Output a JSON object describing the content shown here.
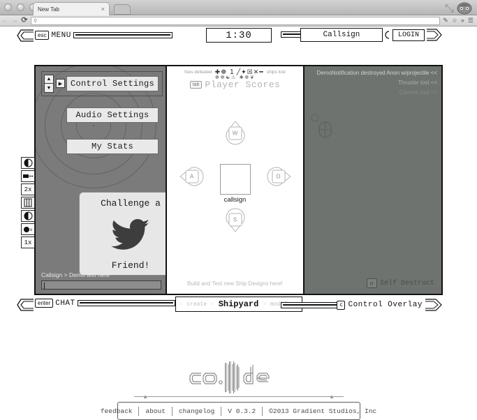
{
  "browser": {
    "tab_title": "New Tab",
    "tab_close": "×",
    "new_tab_icon": "new-tab",
    "back_icon": "←",
    "forward_icon": "→",
    "reload_icon": "⟳",
    "omnibox_search_icon": "⚲",
    "omnibox_value": "",
    "omnibox_placeholder": "",
    "bookmark_icon": "☆",
    "edit_icon": "✎",
    "overflow_icon": "»",
    "menu_icon": "☰",
    "restore_icon": "⤡",
    "avatar_icon": "user-avatar"
  },
  "hud_top": {
    "esc_key": "esc",
    "menu_label": "MENU",
    "timer": "1:30",
    "callsign": "Callsign",
    "login_label": "LOGIN"
  },
  "left_panel": {
    "spinner_up": "▲",
    "spinner_down": "▼",
    "arrow_select": "▶",
    "buttons": [
      {
        "label": "Control Settings"
      },
      {
        "label": "Audio Settings"
      },
      {
        "label": "My Stats"
      }
    ],
    "twitter_card": {
      "line1": "Challenge a",
      "line2": "Friend!",
      "icon": "twitter-bird-icon"
    },
    "chat_log": "Callsign > Demo text here",
    "chat_input_value": ""
  },
  "hidden_items": [
    {
      "icon": "shield-half-icon",
      "label": ""
    },
    {
      "icon": "gun-icon",
      "label": ""
    },
    {
      "icon": "multiplier-icon",
      "label": "2x"
    },
    {
      "icon": "bars-icon",
      "label": ""
    },
    {
      "icon": "shield-half-icon",
      "label": ""
    },
    {
      "icon": "mine-icon",
      "label": ""
    },
    {
      "icon": "multiplier-icon",
      "label": "1x"
    }
  ],
  "center_panel": {
    "foes_label": "foes defeated",
    "ships_label": "ships lost",
    "score": "1",
    "glyph_row_1": "✚☸",
    "glyph_row_2": "╱✦☒✕━",
    "glyph_row_3": "☸☸☯⚠",
    "glyph_row_4": "✱☸❦",
    "tab_key": "tab",
    "scores_label": "Player Scores",
    "keys": {
      "up": "W",
      "left": "A",
      "right": "D",
      "down": "S"
    },
    "ship_caption": "callsign",
    "build_hint": "Build and Test new Ship Designs here!"
  },
  "right_panel": {
    "notifications": [
      {
        "text": "DemoNotification destroyed Anon w/projectile <<",
        "color": "#cfd4cf"
      },
      {
        "text": "Thruster lost <<",
        "color": "#a9aea9"
      },
      {
        "text": "Cannon lost <<",
        "color": "#868b86"
      }
    ],
    "self_destruct_key": "R",
    "self_destruct_label": "Self Destruct",
    "cursor_icon": "mouse-cursor-icon"
  },
  "hud_bottom": {
    "enter_key": "enter",
    "chat_label": "CHAT",
    "shipyard_left": "- create -",
    "shipyard_title": "Shipyard",
    "shipyard_right": "- modify -",
    "overlay_key": "c",
    "overlay_label": "Control Overlay"
  },
  "footer": {
    "logo": "co.llide",
    "links": [
      {
        "label": "feedback",
        "interactable": true
      },
      {
        "label": "about",
        "interactable": true
      },
      {
        "label": "changelog",
        "interactable": true
      },
      {
        "label": "V 0.3.2",
        "interactable": false
      },
      {
        "label": "©2013 Gradient Studios, Inc",
        "interactable": false
      }
    ]
  },
  "colors": {
    "panel_gray": "#7b7b7b",
    "right_panel_gray": "#6f736f",
    "line": "#111111",
    "button_face": "#e9e9e9"
  }
}
